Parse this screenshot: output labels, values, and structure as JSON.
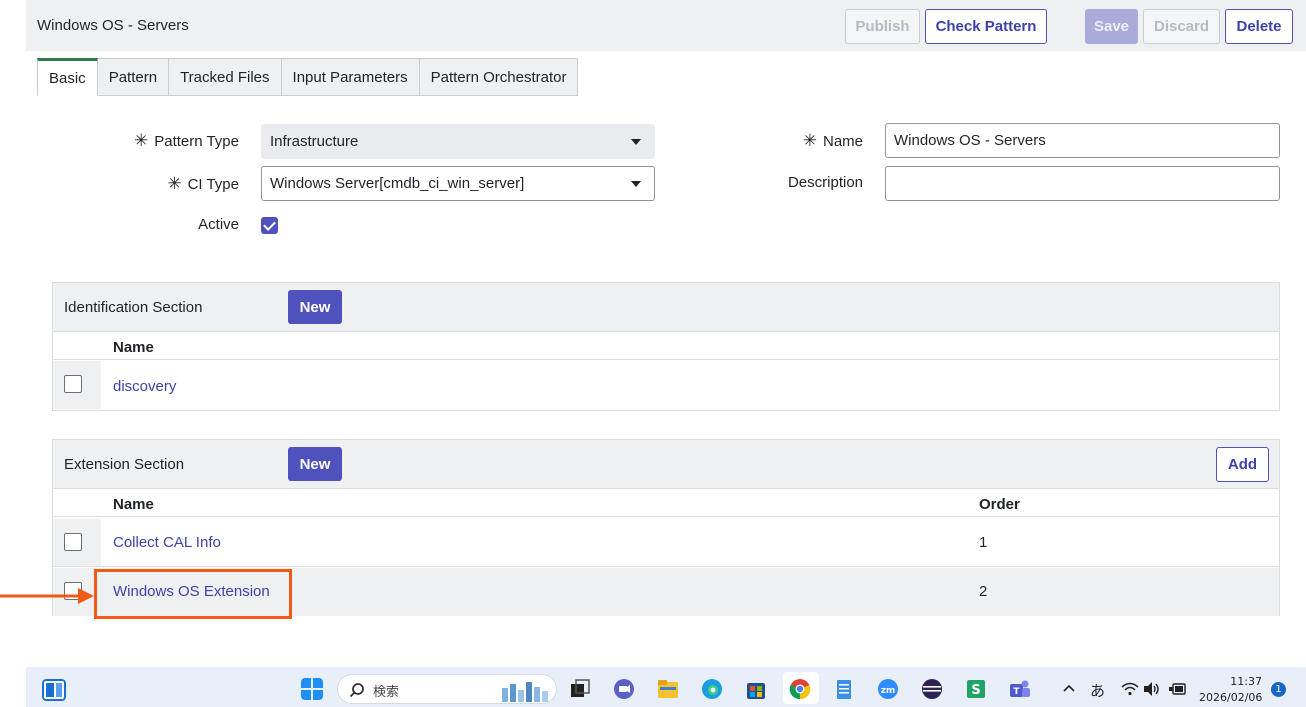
{
  "header": {
    "title": "Windows OS - Servers",
    "publish_label": "Publish",
    "check_pattern_label": "Check Pattern",
    "save_label": "Save",
    "discard_label": "Discard",
    "delete_label": "Delete"
  },
  "tabs": [
    {
      "label": "Basic",
      "active": true
    },
    {
      "label": "Pattern",
      "active": false
    },
    {
      "label": "Tracked Files",
      "active": false
    },
    {
      "label": "Input Parameters",
      "active": false
    },
    {
      "label": "Pattern Orchestrator",
      "active": false
    }
  ],
  "form": {
    "required_mark": "✳",
    "pattern_type_label": "Pattern Type",
    "pattern_type_value": "Infrastructure",
    "ci_type_label": "CI Type",
    "ci_type_value": "Windows Server[cmdb_ci_win_server]",
    "active_label": "Active",
    "active_checked": true,
    "name_label": "Name",
    "name_value": "Windows OS - Servers",
    "description_label": "Description",
    "description_value": ""
  },
  "identification": {
    "title": "Identification Section",
    "new_label": "New",
    "col_name": "Name",
    "rows": [
      {
        "name": "discovery"
      }
    ]
  },
  "extension": {
    "title": "Extension Section",
    "new_label": "New",
    "add_label": "Add",
    "col_name": "Name",
    "col_order": "Order",
    "rows": [
      {
        "name": "Collect CAL Info",
        "order": "1"
      },
      {
        "name": "Windows OS Extension",
        "order": "2"
      }
    ]
  },
  "taskbar": {
    "search_placeholder": "検索",
    "ime": "あ",
    "time": "11:37",
    "date": "2026/02/06",
    "notification_count": "1"
  },
  "colors": {
    "accent": "#4f52bd",
    "link": "#3f42a8",
    "highlight": "#ef5a14",
    "active_tab": "#2e7d4f"
  }
}
